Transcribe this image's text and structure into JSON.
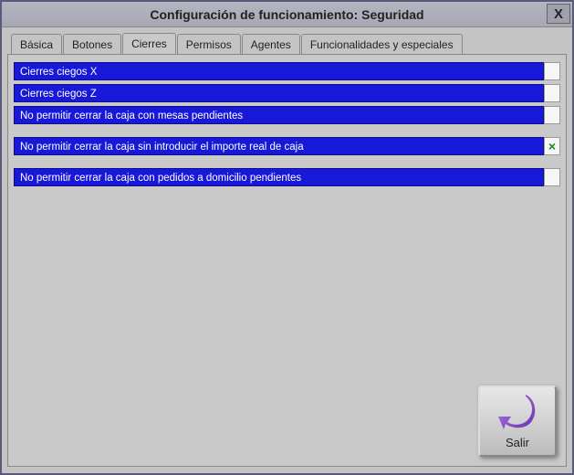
{
  "window": {
    "title": "Configuración de funcionamiento: Seguridad",
    "close_label": "X"
  },
  "tabs": [
    {
      "label": "Básica",
      "active": false
    },
    {
      "label": "Botones",
      "active": false
    },
    {
      "label": "Cierres",
      "active": true
    },
    {
      "label": "Permisos",
      "active": false
    },
    {
      "label": "Agentes",
      "active": false
    },
    {
      "label": "Funcionalidades y especiales",
      "active": false
    }
  ],
  "options": [
    {
      "label": "Cierres ciegos X",
      "checked": false
    },
    {
      "label": "Cierres ciegos Z",
      "checked": false
    },
    {
      "label": "No permitir cerrar la caja con mesas pendientes",
      "checked": false
    },
    {
      "label": "No permitir cerrar la caja sin introducir el importe real de caja",
      "checked": true
    },
    {
      "label": "No permitir cerrar la caja con pedidos a domicilio pendientes",
      "checked": false
    }
  ],
  "buttons": {
    "exit_label": "Salir"
  },
  "colors": {
    "option_bg": "#1818d8",
    "option_fg": "#ffffff",
    "check_color": "#1a8a1a"
  }
}
